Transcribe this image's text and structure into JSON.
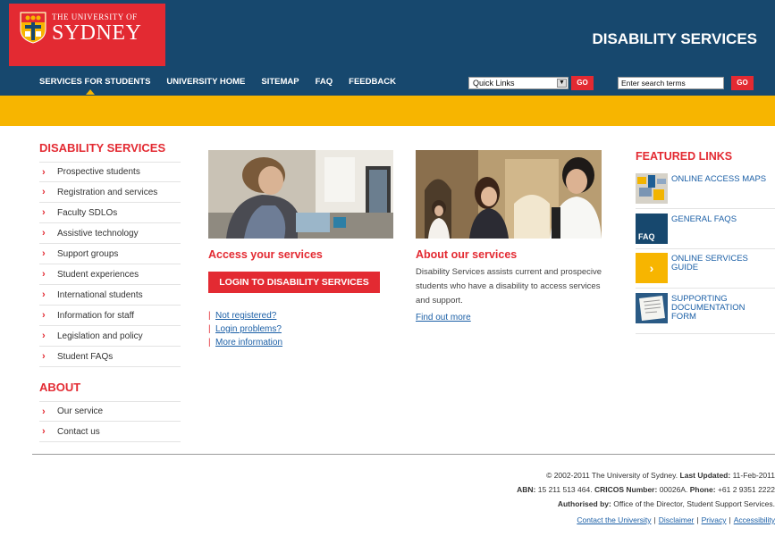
{
  "header": {
    "university_line": "THE UNIVERSITY OF",
    "university_name": "SYDNEY",
    "site_title": "DISABILITY SERVICES",
    "colors": {
      "blue": "#17486e",
      "red": "#e32a32",
      "yellow": "#f7b500"
    }
  },
  "nav": {
    "items": [
      {
        "label": "SERVICES FOR STUDENTS"
      },
      {
        "label": "UNIVERSITY HOME"
      },
      {
        "label": "SITEMAP"
      },
      {
        "label": "FAQ"
      },
      {
        "label": "FEEDBACK"
      }
    ],
    "quick_links": "Quick Links",
    "go_label": "GO",
    "search_value": "Enter search terms"
  },
  "sidebar": {
    "heading1": "DISABILITY SERVICES",
    "items1": [
      {
        "label": "Prospective students"
      },
      {
        "label": "Registration and services"
      },
      {
        "label": "Faculty SDLOs"
      },
      {
        "label": "Assistive technology"
      },
      {
        "label": "Support groups"
      },
      {
        "label": "Student experiences"
      },
      {
        "label": "International students"
      },
      {
        "label": "Information for staff"
      },
      {
        "label": "Legislation and policy"
      },
      {
        "label": "Student FAQs"
      }
    ],
    "heading2": "ABOUT",
    "items2": [
      {
        "label": "Our service"
      },
      {
        "label": "Contact us"
      }
    ],
    "chevron": "›"
  },
  "access": {
    "heading": "Access your services",
    "login_button": "LOGIN TO DISABILITY SERVICES",
    "links": [
      {
        "label": "Not registered?"
      },
      {
        "label": "Login problems?"
      },
      {
        "label": "More information"
      }
    ]
  },
  "about": {
    "heading": "About our services",
    "text": "Disability Services assists current and prospecive students who have a disability to access services and support.",
    "find_out": "Find out more"
  },
  "featured": {
    "heading": "FEATURED LINKS",
    "items": [
      {
        "label": "ONLINE ACCESS MAPS",
        "icon": "map-icon"
      },
      {
        "label": "GENERAL FAQS",
        "icon": "faq-icon",
        "thumb_text": "FAQ"
      },
      {
        "label": "ONLINE SERVICES GUIDE",
        "icon": "arrow-icon",
        "thumb_text": "›"
      },
      {
        "label": "SUPPORTING DOCUMENTATION FORM",
        "icon": "document-icon"
      }
    ]
  },
  "footer": {
    "line1_prefix": "© 2002-2011 The University of Sydney.",
    "line1_label": "Last Updated:",
    "line1_value": "11-Feb-2011",
    "abn_label": "ABN:",
    "abn_value": "15 211 513 464.",
    "cricos_label": "CRICOS Number:",
    "cricos_value": "00026A.",
    "phone_label": "Phone:",
    "phone_value": "+61 2 9351 2222",
    "authorised_label": "Authorised by:",
    "authorised_value": "Office of the Director, Student Support Services.",
    "links": [
      {
        "label": "Contact the University"
      },
      {
        "label": "Disclaimer"
      },
      {
        "label": "Privacy"
      },
      {
        "label": "Accessibility"
      }
    ],
    "separator": "|"
  }
}
